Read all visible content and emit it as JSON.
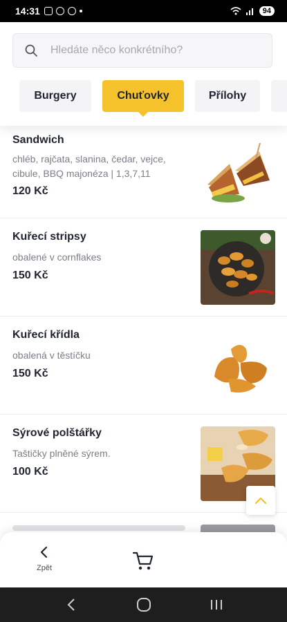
{
  "status_bar": {
    "time": "14:31",
    "battery": "94"
  },
  "search": {
    "placeholder": "Hledáte něco konkrétního?"
  },
  "tabs": [
    {
      "label": "Burgery",
      "active": false
    },
    {
      "label": "Chuťovky",
      "active": true
    },
    {
      "label": "Přílohy",
      "active": false
    }
  ],
  "items": [
    {
      "name": "Sandwich",
      "description": "chléb, rajčata, slanina, čedar, vejce, cibule, BBQ majonéza | 1,3,7,11",
      "price": "120 Kč"
    },
    {
      "name": "Kuřecí stripsy",
      "description": "obalené v cornflakes",
      "price": "150 Kč"
    },
    {
      "name": "Kuřecí křídla",
      "description": "obalená v těstíčku",
      "price": "150 Kč"
    },
    {
      "name": "Sýrové polštářky",
      "description": "Taštičky plněné sýrem.",
      "price": "100 Kč"
    }
  ],
  "bottom_bar": {
    "back_label": "Zpět"
  },
  "colors": {
    "accent": "#f5c22b",
    "text": "#1f2330",
    "muted": "#7b7e88"
  }
}
